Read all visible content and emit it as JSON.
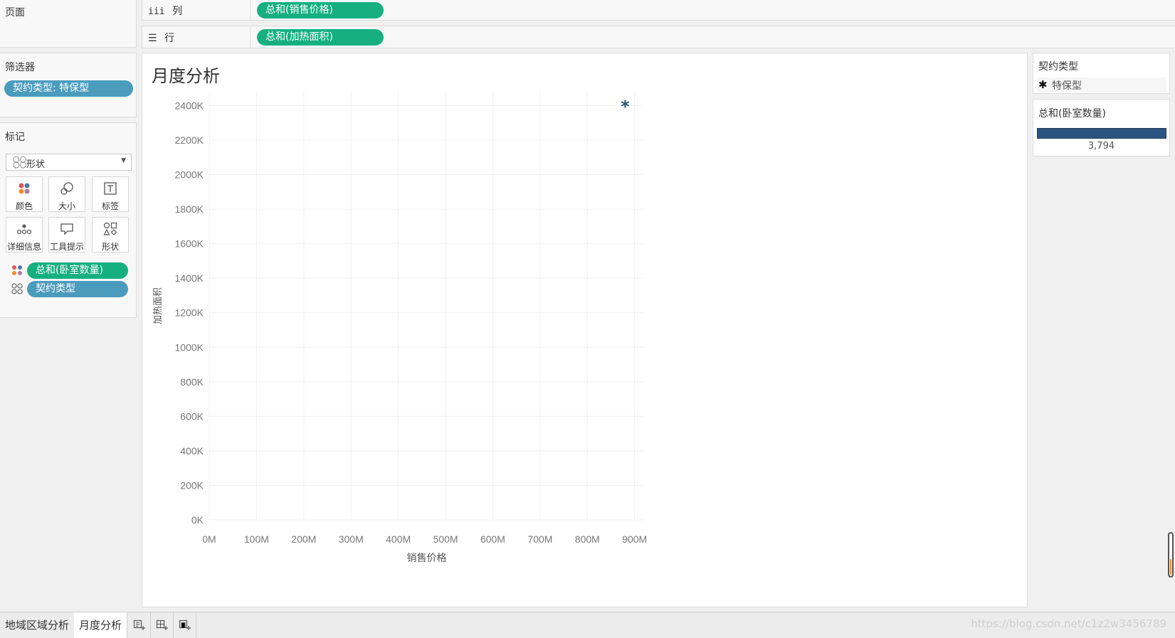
{
  "pages_panel": {
    "title": "页面"
  },
  "shelves": {
    "columns": {
      "label": "列",
      "pill": "总和(销售价格)"
    },
    "rows": {
      "label": "行",
      "pill": "总和(加热面积)"
    }
  },
  "filters_panel": {
    "title": "筛选器",
    "pill": "契约类型: 特保型"
  },
  "marks_panel": {
    "title": "标记",
    "mark_type": "形状",
    "buttons": [
      {
        "label": "颜色",
        "icon": "color-icon"
      },
      {
        "label": "大小",
        "icon": "size-icon"
      },
      {
        "label": "标签",
        "icon": "label-icon"
      },
      {
        "label": "详细信息",
        "icon": "detail-icon"
      },
      {
        "label": "工具提示",
        "icon": "tooltip-icon"
      },
      {
        "label": "形状",
        "icon": "shape-icon"
      }
    ],
    "fields": [
      {
        "label": "总和(卧室数量)",
        "type": "color"
      },
      {
        "label": "契约类型",
        "type": "shape"
      }
    ]
  },
  "chart_data": {
    "type": "scatter",
    "title": "月度分析",
    "xlabel": "销售价格",
    "ylabel": "加热面积",
    "xlim": [
      0,
      920
    ],
    "ylim": [
      0,
      2480
    ],
    "x_ticks": [
      0,
      100,
      200,
      300,
      400,
      500,
      600,
      700,
      800,
      900
    ],
    "x_tick_labels": [
      "0M",
      "100M",
      "200M",
      "300M",
      "400M",
      "500M",
      "600M",
      "700M",
      "800M",
      "900M"
    ],
    "y_ticks": [
      0,
      200,
      400,
      600,
      800,
      1000,
      1200,
      1400,
      1600,
      1800,
      2000,
      2200,
      2400
    ],
    "y_tick_labels": [
      "0K",
      "200K",
      "400K",
      "600K",
      "800K",
      "1000K",
      "1200K",
      "1400K",
      "1600K",
      "1800K",
      "2000K",
      "2200K",
      "2400K"
    ],
    "grid": true,
    "points": [
      {
        "x": 880,
        "y": 2410,
        "shape": "*",
        "color": "#2c5480"
      }
    ]
  },
  "legend_shape": {
    "title": "契约类型",
    "items": [
      {
        "symbol": "✱",
        "label": "特保型"
      }
    ]
  },
  "legend_color": {
    "title": "总和(卧室数量)",
    "value": "3,794",
    "color": "#2c5480"
  },
  "tabs": [
    {
      "label": "地域区域分析",
      "active": false
    },
    {
      "label": "月度分析",
      "active": true
    }
  ],
  "tab_icons": [
    "new-worksheet-icon",
    "new-dashboard-icon",
    "new-story-icon"
  ],
  "watermark": "https://blog.csdn.net/c1z2w3456789"
}
